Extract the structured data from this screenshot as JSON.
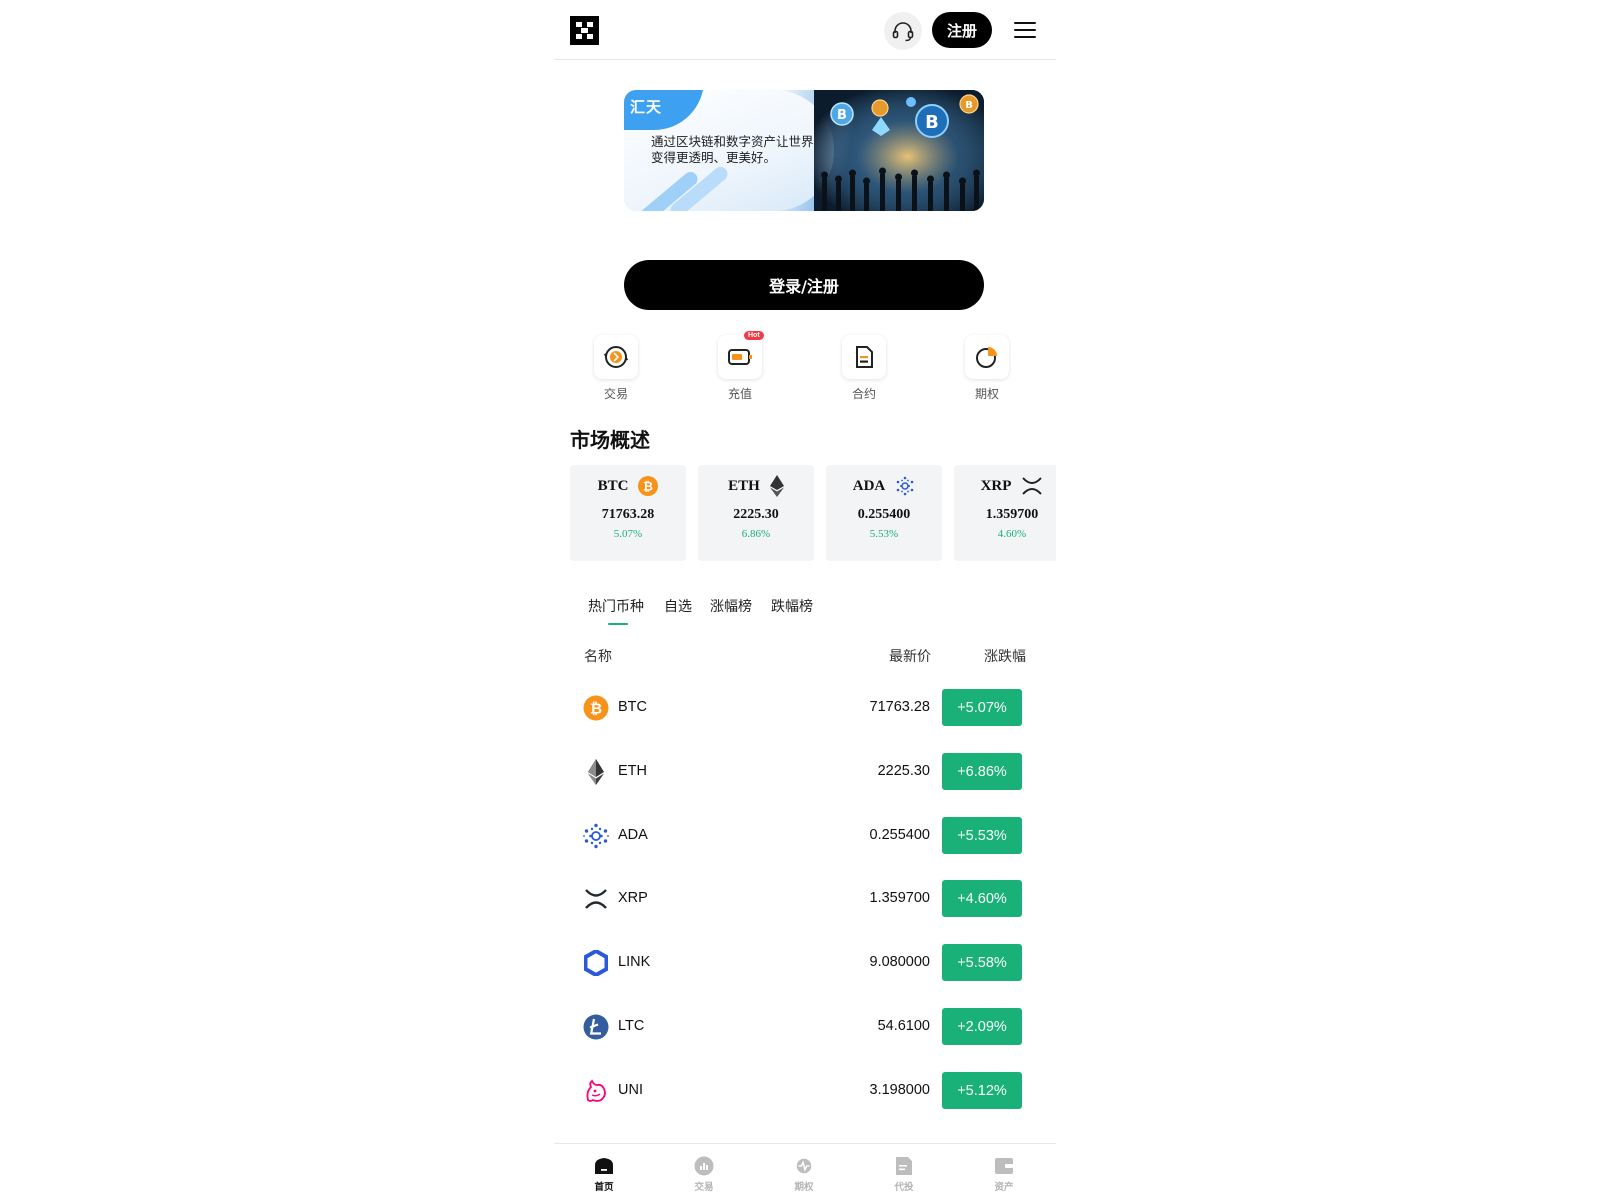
{
  "header": {
    "signup_label": "注册"
  },
  "banner": {
    "brand": "汇天",
    "text": "通过区块链和数字资产让世界变得更透明、更美好。"
  },
  "login_label": "登录/注册",
  "actions": [
    {
      "label": "交易",
      "icon": "trade-exchange-icon"
    },
    {
      "label": "充值",
      "icon": "deposit-icon",
      "badge": "Hot"
    },
    {
      "label": "合约",
      "icon": "contract-document-icon"
    },
    {
      "label": "期权",
      "icon": "options-pie-icon"
    }
  ],
  "market": {
    "title": "市场概述",
    "cards": [
      {
        "symbol": "BTC",
        "price": "71763.28",
        "change": "5.07%"
      },
      {
        "symbol": "ETH",
        "price": "2225.30",
        "change": "6.86%"
      },
      {
        "symbol": "ADA",
        "price": "0.255400",
        "change": "5.53%"
      },
      {
        "symbol": "XRP",
        "price": "1.359700",
        "change": "4.60%"
      }
    ]
  },
  "tabs": [
    "热门币种",
    "自选",
    "涨幅榜",
    "跌幅榜"
  ],
  "table": {
    "headers": {
      "name": "名称",
      "price": "最新价",
      "change": "涨跌幅"
    },
    "rows": [
      {
        "symbol": "BTC",
        "price": "71763.28",
        "change": "+5.07%"
      },
      {
        "symbol": "ETH",
        "price": "2225.30",
        "change": "+6.86%"
      },
      {
        "symbol": "ADA",
        "price": "0.255400",
        "change": "+5.53%"
      },
      {
        "symbol": "XRP",
        "price": "1.359700",
        "change": "+4.60%"
      },
      {
        "symbol": "LINK",
        "price": "9.080000",
        "change": "+5.58%"
      },
      {
        "symbol": "LTC",
        "price": "54.6100",
        "change": "+2.09%"
      },
      {
        "symbol": "UNI",
        "price": "3.198000",
        "change": "+5.12%"
      }
    ]
  },
  "bottom_nav": [
    {
      "label": "首页",
      "active": true
    },
    {
      "label": "交易"
    },
    {
      "label": "期权"
    },
    {
      "label": "代投"
    },
    {
      "label": "资产"
    }
  ],
  "colors": {
    "accent_green": "#19b178",
    "primary_black": "#000000",
    "btc_orange": "#f7931a",
    "hot_red": "#f23b46"
  }
}
